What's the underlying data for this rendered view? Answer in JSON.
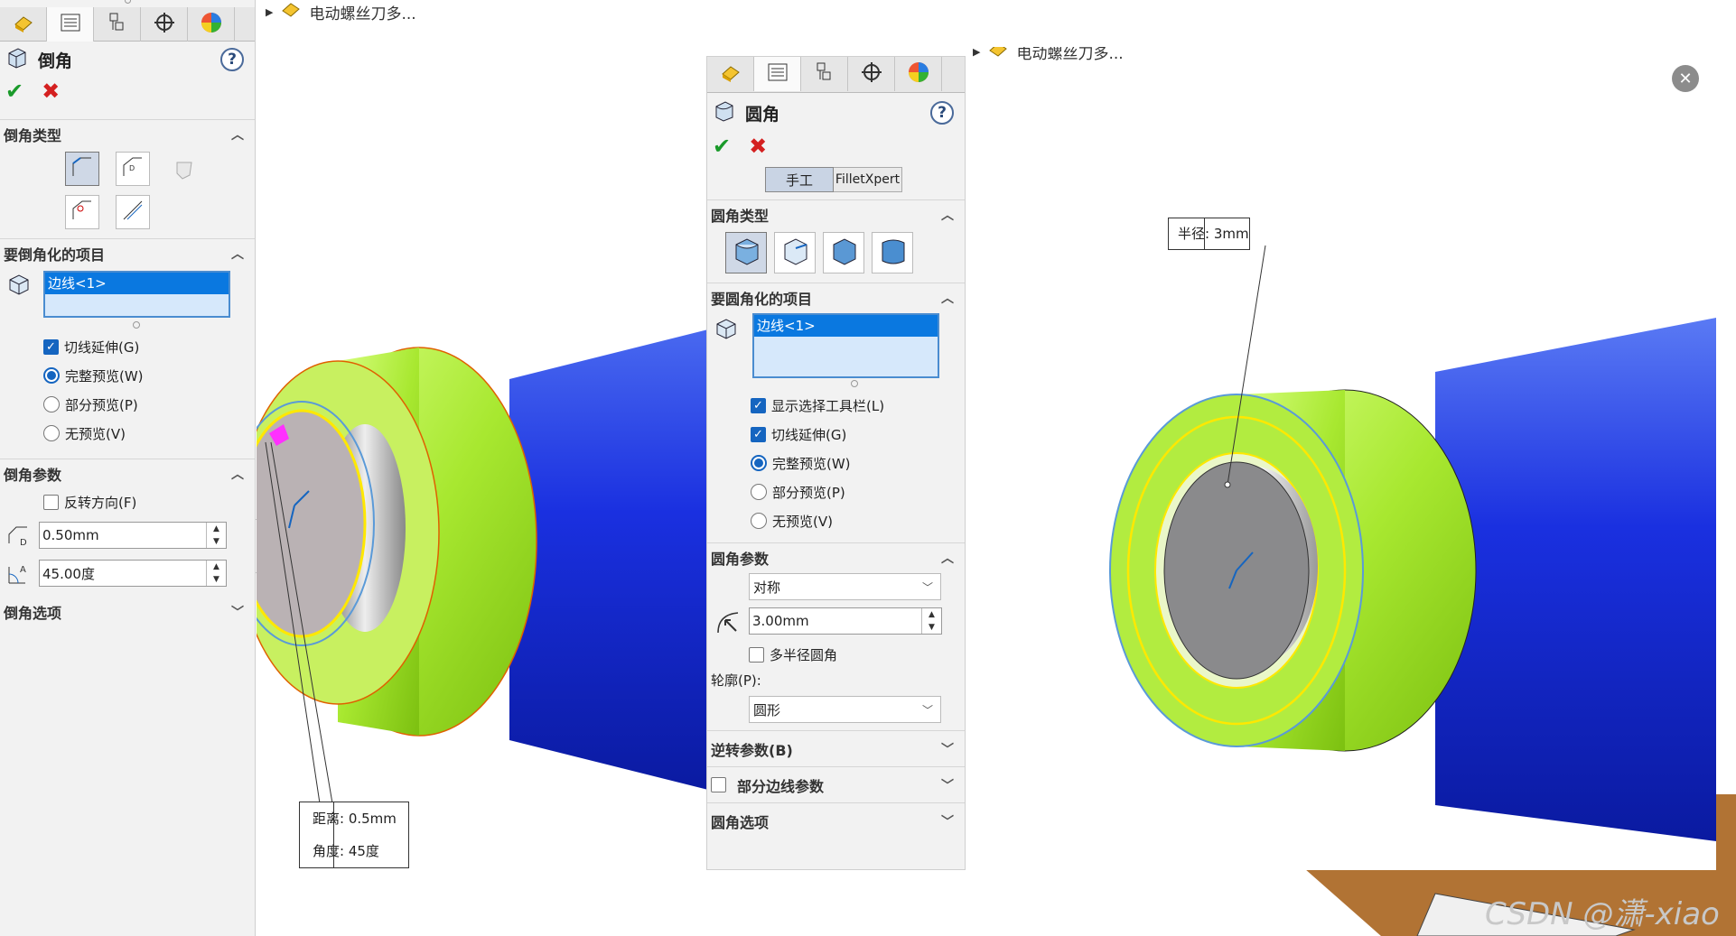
{
  "breadcrumb": {
    "top_label": "电动螺丝刀多...",
    "right_label": "电动螺丝刀多..."
  },
  "left_panel": {
    "title": "倒角",
    "tabs": [
      "feature-manager-icon",
      "property-manager-icon",
      "config-manager-icon",
      "dim-xpert-icon",
      "display-manager-icon"
    ],
    "section_type": "倒角类型",
    "section_items": "要倒角化的项目",
    "selected_item": "边线<1>",
    "opt_tangent": "切线延伸(G)",
    "opt_full_preview": "完整预览(W)",
    "opt_partial_preview": "部分预览(P)",
    "opt_no_preview": "无预览(V)",
    "section_params": "倒角参数",
    "opt_reverse": "反转方向(F)",
    "distance_value": "0.50mm",
    "angle_value": "45.00度",
    "section_options": "倒角选项"
  },
  "left_callout": {
    "distance": "距离: 0.5mm",
    "angle": "角度: 45度"
  },
  "right_panel": {
    "title": "圆角",
    "mode_manual": "手工",
    "mode_xpert": "FilletXpert",
    "section_type": "圆角类型",
    "section_items": "要圆角化的项目",
    "selected_item": "边线<1>",
    "opt_toolbar": "显示选择工具栏(L)",
    "opt_tangent": "切线延伸(G)",
    "opt_full_preview": "完整预览(W)",
    "opt_partial_preview": "部分预览(P)",
    "opt_no_preview": "无预览(V)",
    "section_params": "圆角参数",
    "symmetric": "对称",
    "radius_value": "3.00mm",
    "opt_multi_radius": "多半径圆角",
    "profile_label": "轮廓(P):",
    "profile_value": "圆形",
    "section_setback": "逆转参数(B)",
    "section_partial_edge": "部分边线参数",
    "section_options": "圆角选项"
  },
  "right_callout": {
    "radius": "半径: 3mm"
  },
  "watermark": "CSDN @潇-xiao",
  "colors": {
    "accent_blue": "#0a78e0",
    "body_blue": "#1e3ee0",
    "fillet_green": "#b8f040",
    "ok_green": "#1a9a2a",
    "cancel_red": "#d42020"
  }
}
